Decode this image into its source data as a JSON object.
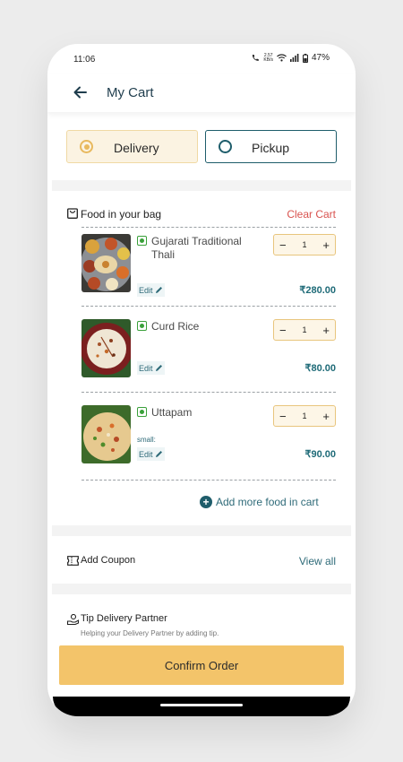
{
  "status": {
    "time": "11:06",
    "speed_top": "2.57",
    "speed_unit": "KB/s",
    "battery": "47%"
  },
  "header": {
    "title": "My Cart"
  },
  "modes": {
    "delivery": "Delivery",
    "pickup": "Pickup",
    "selected": "Delivery"
  },
  "bag": {
    "title": "Food in your bag",
    "clear_label": "Clear Cart"
  },
  "items": [
    {
      "name": "Gujarati Traditional Thali",
      "quantity": 1,
      "price": "₹280.00",
      "edit_label": "Edit",
      "note": ""
    },
    {
      "name": "Curd Rice",
      "quantity": 1,
      "price": "₹80.00",
      "edit_label": "Edit",
      "note": ""
    },
    {
      "name": "Uttapam",
      "quantity": 1,
      "price": "₹90.00",
      "edit_label": "Edit",
      "note": "small:"
    }
  ],
  "add_more_label": "Add more food in cart",
  "coupon": {
    "title": "Add Coupon",
    "view_all": "View all"
  },
  "tip": {
    "title": "Tip Delivery Partner",
    "subtitle": "Helping your Delivery Partner by adding tip."
  },
  "confirm_label": "Confirm Order",
  "colors": {
    "accent": "#f3c46a",
    "teal": "#1f5d6b",
    "clear": "#d9534f",
    "veg": "#3aa03a"
  }
}
